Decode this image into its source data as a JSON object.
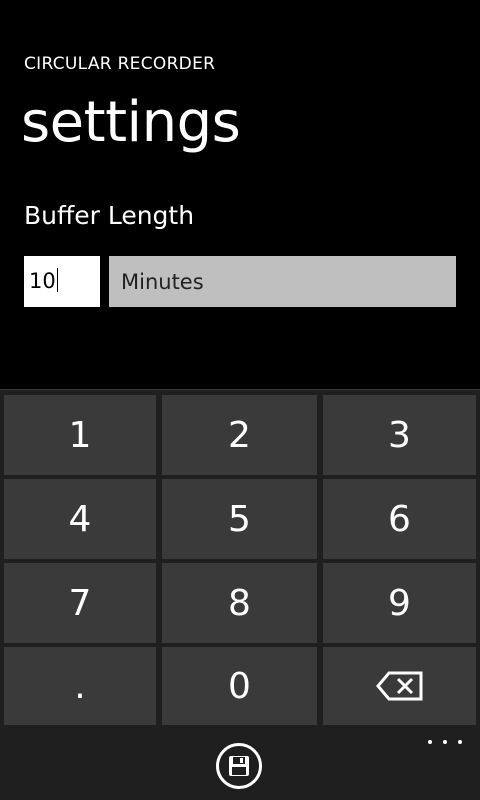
{
  "header": {
    "app_title": "CIRCULAR RECORDER",
    "page_title": "settings"
  },
  "buffer": {
    "label": "Buffer Length",
    "value": "10",
    "unit": "Minutes"
  },
  "keypad": {
    "keys": [
      "1",
      "2",
      "3",
      "4",
      "5",
      "6",
      "7",
      "8",
      "9",
      ".",
      "0",
      "backspace"
    ]
  },
  "app_bar": {
    "save_icon": "save-icon",
    "more_icon": "ellipsis-icon"
  },
  "colors": {
    "background": "#000000",
    "key": "#3a3a3a",
    "panel": "#1f1f1f",
    "unit_field": "#bfbfbf"
  }
}
